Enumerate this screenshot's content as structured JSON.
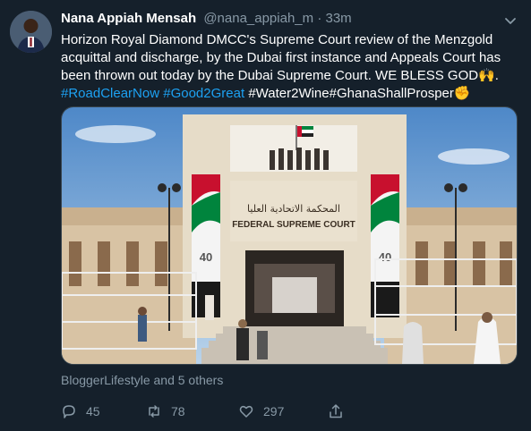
{
  "tweet": {
    "author_name": "Nana Appiah Mensah",
    "handle": "@nana_appiah_m",
    "separator": "·",
    "time": "33m",
    "text_line1": "Horizon Royal Diamond DMCC's  Supreme Court review of the Menzgold",
    "text_line2": "acquittal and discharge, by the Dubai first instance and Appeals Court has",
    "text_line3": "been thrown out today by the Dubai Supreme Court. WE BLESS GOD🙌.",
    "hashtag1": "#RoadClearNow",
    "hashtag2": "#Good2Great",
    "hashtag3": "#Water2Wine#GhanaShallProsper",
    "emoji_end": "✊",
    "social_context": "BloggerLifestyle and 5 others",
    "image_sign_arabic": "المحكمة الاتحادية العليا",
    "image_sign_english": "FEDERAL SUPREME COURT",
    "banner_number": "40"
  },
  "actions": {
    "replies": "45",
    "retweets": "78",
    "likes": "297"
  },
  "colors": {
    "background": "#15202b",
    "link": "#1da1f2",
    "muted": "#8899a6"
  },
  "icons": [
    "chevron-down-icon",
    "reply-icon",
    "retweet-icon",
    "like-icon",
    "share-icon"
  ]
}
